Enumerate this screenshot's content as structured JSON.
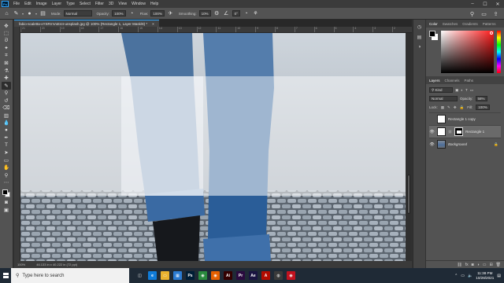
{
  "app": {
    "logo": "Ps"
  },
  "menu": [
    "File",
    "Edit",
    "Image",
    "Layer",
    "Type",
    "Select",
    "Filter",
    "3D",
    "View",
    "Window",
    "Help"
  ],
  "window_controls": [
    "–",
    "☐",
    "✕"
  ],
  "options": {
    "brush_size": "●",
    "mode_label": "Mode:",
    "mode_value": "Normal",
    "opacity_label": "Opacity:",
    "opacity_value": "100%",
    "flow_label": "Flow:",
    "flow_value": "100%",
    "smoothing_label": "Smoothing:",
    "smoothing_value": "10%",
    "angle_value": "0°"
  },
  "document": {
    "tab_title": "fabio-scaletta-xYSRrnVxE44-unsplash.jpg @ 100% (Rectangle 1, Layer Mask/8) *",
    "tab_close": "×",
    "ruler_ticks": [
      "21",
      "20",
      "19",
      "18",
      "17",
      "16",
      "15",
      "14",
      "13",
      "12",
      "11",
      "10",
      "9",
      "8",
      "7",
      "6",
      "5",
      "4",
      "3",
      "2"
    ],
    "zoom": "100%",
    "doc_size": "46.133 in x 40.222 in (72 ppi)"
  },
  "color_panel": {
    "tabs": [
      "Color",
      "Swatches",
      "Gradients",
      "Patterns"
    ],
    "hue_color": "#ff1a1a"
  },
  "layers_panel": {
    "tabs": [
      "Layers",
      "Channels",
      "Paths"
    ],
    "kind_label": "Kind",
    "blend_mode": "Normal",
    "opacity_label": "Opacity:",
    "opacity_value": "58%",
    "lock_label": "Lock:",
    "fill_label": "Fill:",
    "fill_value": "100%",
    "layers": [
      {
        "name": "Rectangle 1 copy",
        "visible": false,
        "selected": false
      },
      {
        "name": "Rectangle 1",
        "visible": true,
        "selected": true
      },
      {
        "name": "Background",
        "visible": true,
        "selected": false
      }
    ]
  },
  "taskbar": {
    "search_placeholder": "Type here to search",
    "apps": [
      {
        "name": "task-view",
        "glyph": "◫",
        "color": "#1f2a36"
      },
      {
        "name": "edge",
        "glyph": "e",
        "color": "#0f7bd8"
      },
      {
        "name": "file-explorer",
        "glyph": "▭",
        "color": "#e8b22f"
      },
      {
        "name": "store",
        "glyph": "▦",
        "color": "#2b7bd2"
      },
      {
        "name": "photoshop",
        "glyph": "Ps",
        "color": "#001e36"
      },
      {
        "name": "chrome",
        "glyph": "◉",
        "color": "#2a8a3e"
      },
      {
        "name": "firefox",
        "glyph": "◉",
        "color": "#e66000"
      },
      {
        "name": "illustrator",
        "glyph": "Ai",
        "color": "#330000"
      },
      {
        "name": "premiere",
        "glyph": "Pr",
        "color": "#2a0b3f"
      },
      {
        "name": "after-effects",
        "glyph": "Ae",
        "color": "#1a1441"
      },
      {
        "name": "acrobat",
        "glyph": "A",
        "color": "#b30b00"
      },
      {
        "name": "davinci",
        "glyph": "◍",
        "color": "#3a3a3a"
      },
      {
        "name": "obs",
        "glyph": "◉",
        "color": "#c1121f"
      }
    ],
    "time": "11:38 PM",
    "date": "10/28/2021"
  }
}
